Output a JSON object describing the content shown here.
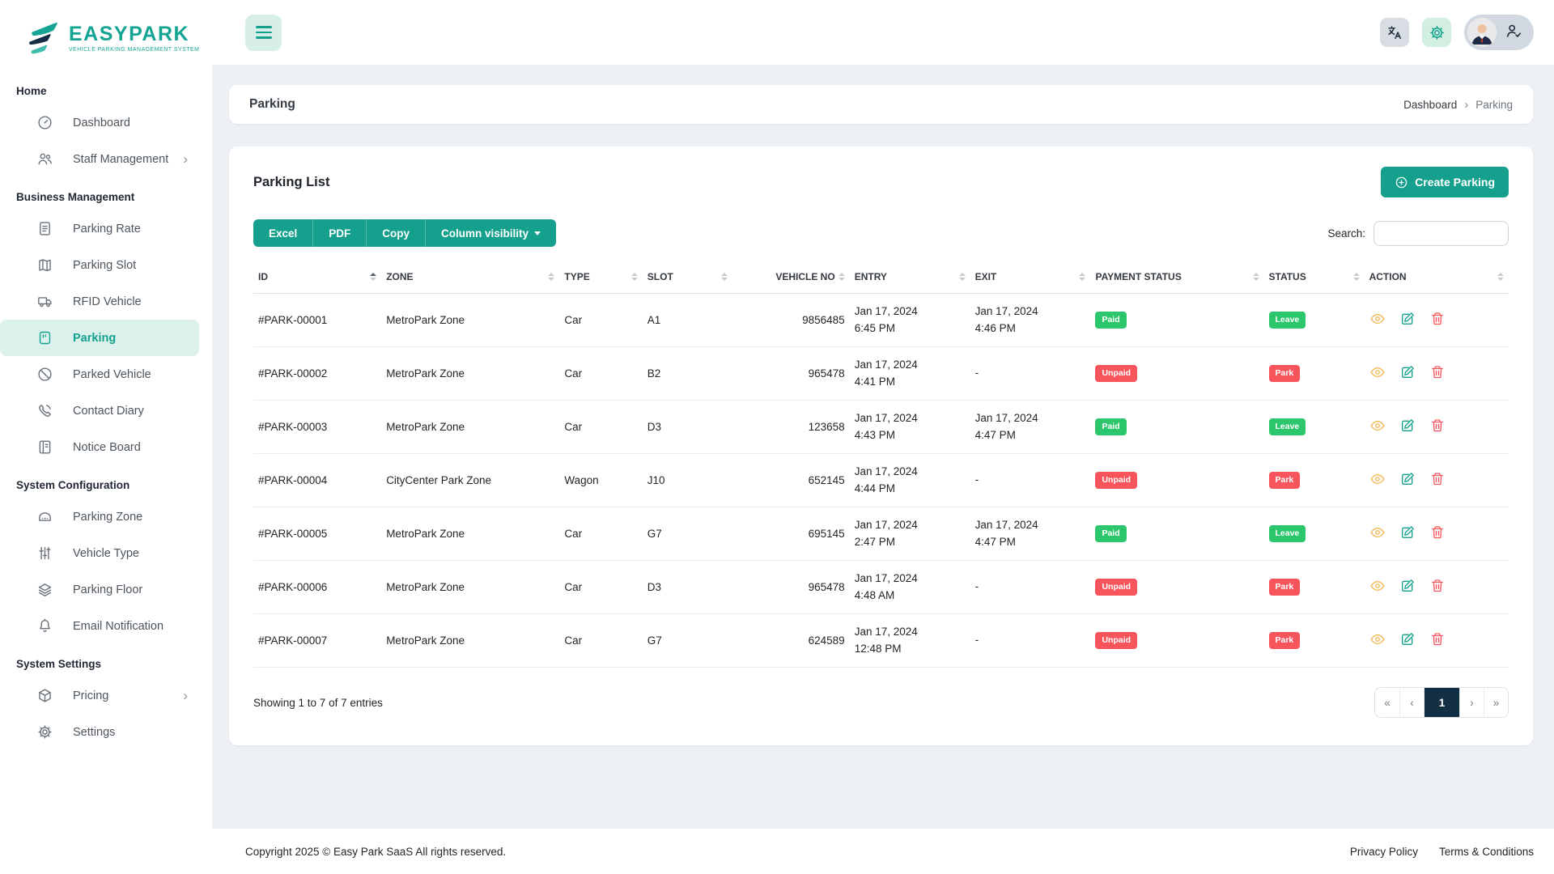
{
  "brand": {
    "name": "EASYPARK",
    "tagline": "VEHICLE PARKING MANAGEMENT SYSTEM"
  },
  "sidebar": {
    "sections": [
      {
        "title": "Home",
        "items": [
          {
            "label": "Dashboard",
            "icon": "speedometer-icon",
            "active": false,
            "has_submenu": false
          },
          {
            "label": "Staff Management",
            "icon": "people-icon",
            "active": false,
            "has_submenu": true
          }
        ]
      },
      {
        "title": "Business Management",
        "items": [
          {
            "label": "Parking Rate",
            "icon": "file-text-icon",
            "active": false,
            "has_submenu": false
          },
          {
            "label": "Parking Slot",
            "icon": "map-icon",
            "active": false,
            "has_submenu": false
          },
          {
            "label": "RFID Vehicle",
            "icon": "truck-icon",
            "active": false,
            "has_submenu": false
          },
          {
            "label": "Parking",
            "icon": "parking-meter-icon",
            "active": true,
            "has_submenu": false
          },
          {
            "label": "Parked Vehicle",
            "icon": "slash-circle-icon",
            "active": false,
            "has_submenu": false
          },
          {
            "label": "Contact Diary",
            "icon": "phone-icon",
            "active": false,
            "has_submenu": false
          },
          {
            "label": "Notice Board",
            "icon": "notice-board-icon",
            "active": false,
            "has_submenu": false
          }
        ]
      },
      {
        "title": "System Configuration",
        "items": [
          {
            "label": "Parking Zone",
            "icon": "garage-icon",
            "active": false,
            "has_submenu": false
          },
          {
            "label": "Vehicle Type",
            "icon": "sliders-icon",
            "active": false,
            "has_submenu": false
          },
          {
            "label": "Parking Floor",
            "icon": "layers-icon",
            "active": false,
            "has_submenu": false
          },
          {
            "label": "Email Notification",
            "icon": "bell-icon",
            "active": false,
            "has_submenu": false
          }
        ]
      },
      {
        "title": "System Settings",
        "items": [
          {
            "label": "Pricing",
            "icon": "box-icon",
            "active": false,
            "has_submenu": true
          },
          {
            "label": "Settings",
            "icon": "gear-icon",
            "active": false,
            "has_submenu": false
          }
        ]
      }
    ]
  },
  "topbar": {
    "icons": [
      "hamburger-icon",
      "translate-icon",
      "gear-icon",
      "avatar",
      "person-check-icon"
    ]
  },
  "page": {
    "title": "Parking",
    "breadcrumb": {
      "root": "Dashboard",
      "separator": "›",
      "current": "Parking"
    }
  },
  "card": {
    "title": "Parking List",
    "create_button": "Create Parking",
    "export_buttons": [
      "Excel",
      "PDF",
      "Copy"
    ],
    "column_visibility_label": "Column visibility",
    "search_label": "Search:",
    "search_value": ""
  },
  "table": {
    "columns": [
      {
        "label": "ID",
        "align": "left",
        "sorted": "asc"
      },
      {
        "label": "ZONE",
        "align": "left",
        "sorted": null
      },
      {
        "label": "TYPE",
        "align": "left",
        "sorted": null
      },
      {
        "label": "SLOT",
        "align": "left",
        "sorted": null
      },
      {
        "label": "VEHICLE NO",
        "align": "right",
        "sorted": null
      },
      {
        "label": "ENTRY",
        "align": "left",
        "sorted": null
      },
      {
        "label": "EXIT",
        "align": "left",
        "sorted": null
      },
      {
        "label": "PAYMENT STATUS",
        "align": "left",
        "sorted": null
      },
      {
        "label": "STATUS",
        "align": "left",
        "sorted": null
      },
      {
        "label": "ACTION",
        "align": "left",
        "sorted": null
      }
    ],
    "row_actions": [
      "view",
      "edit",
      "delete"
    ],
    "rows": [
      {
        "id": "#PARK-00001",
        "zone": "MetroPark Zone",
        "type": "Car",
        "slot": "A1",
        "vehicle_no": "9856485",
        "entry_date": "Jan 17, 2024",
        "entry_time": "6:45 PM",
        "exit_date": "Jan 17, 2024",
        "exit_time": "4:46 PM",
        "payment_status": "Paid",
        "status": "Leave"
      },
      {
        "id": "#PARK-00002",
        "zone": "MetroPark Zone",
        "type": "Car",
        "slot": "B2",
        "vehicle_no": "965478",
        "entry_date": "Jan 17, 2024",
        "entry_time": "4:41 PM",
        "exit_date": "-",
        "exit_time": "",
        "payment_status": "Unpaid",
        "status": "Park"
      },
      {
        "id": "#PARK-00003",
        "zone": "MetroPark Zone",
        "type": "Car",
        "slot": "D3",
        "vehicle_no": "123658",
        "entry_date": "Jan 17, 2024",
        "entry_time": "4:43 PM",
        "exit_date": "Jan 17, 2024",
        "exit_time": "4:47 PM",
        "payment_status": "Paid",
        "status": "Leave"
      },
      {
        "id": "#PARK-00004",
        "zone": "CityCenter Park Zone",
        "type": "Wagon",
        "slot": "J10",
        "vehicle_no": "652145",
        "entry_date": "Jan 17, 2024",
        "entry_time": "4:44 PM",
        "exit_date": "-",
        "exit_time": "",
        "payment_status": "Unpaid",
        "status": "Park"
      },
      {
        "id": "#PARK-00005",
        "zone": "MetroPark Zone",
        "type": "Car",
        "slot": "G7",
        "vehicle_no": "695145",
        "entry_date": "Jan 17, 2024",
        "entry_time": "2:47 PM",
        "exit_date": "Jan 17, 2024",
        "exit_time": "4:47 PM",
        "payment_status": "Paid",
        "status": "Leave"
      },
      {
        "id": "#PARK-00006",
        "zone": "MetroPark Zone",
        "type": "Car",
        "slot": "D3",
        "vehicle_no": "965478",
        "entry_date": "Jan 17, 2024",
        "entry_time": "4:48 AM",
        "exit_date": "-",
        "exit_time": "",
        "payment_status": "Unpaid",
        "status": "Park"
      },
      {
        "id": "#PARK-00007",
        "zone": "MetroPark Zone",
        "type": "Car",
        "slot": "G7",
        "vehicle_no": "624589",
        "entry_date": "Jan 17, 2024",
        "entry_time": "12:48 PM",
        "exit_date": "-",
        "exit_time": "",
        "payment_status": "Unpaid",
        "status": "Park"
      }
    ],
    "footer": {
      "info": "Showing 1 to 7 of 7 entries",
      "pages": [
        {
          "label": "«",
          "active": false
        },
        {
          "label": "‹",
          "active": false
        },
        {
          "label": "1",
          "active": true
        },
        {
          "label": "›",
          "active": false
        },
        {
          "label": "»",
          "active": false
        }
      ]
    }
  },
  "footer": {
    "copyright": "Copyright 2025 © Easy Park SaaS All rights reserved.",
    "links": [
      "Privacy Policy",
      "Terms & Conditions"
    ]
  },
  "colors": {
    "primary": "#14a08d",
    "badge_green": "#2cc76c",
    "badge_red": "#f8545c",
    "pagination_active": "#132f44",
    "view_icon": "#f3b64d",
    "content_bg": "#edf1f5"
  }
}
